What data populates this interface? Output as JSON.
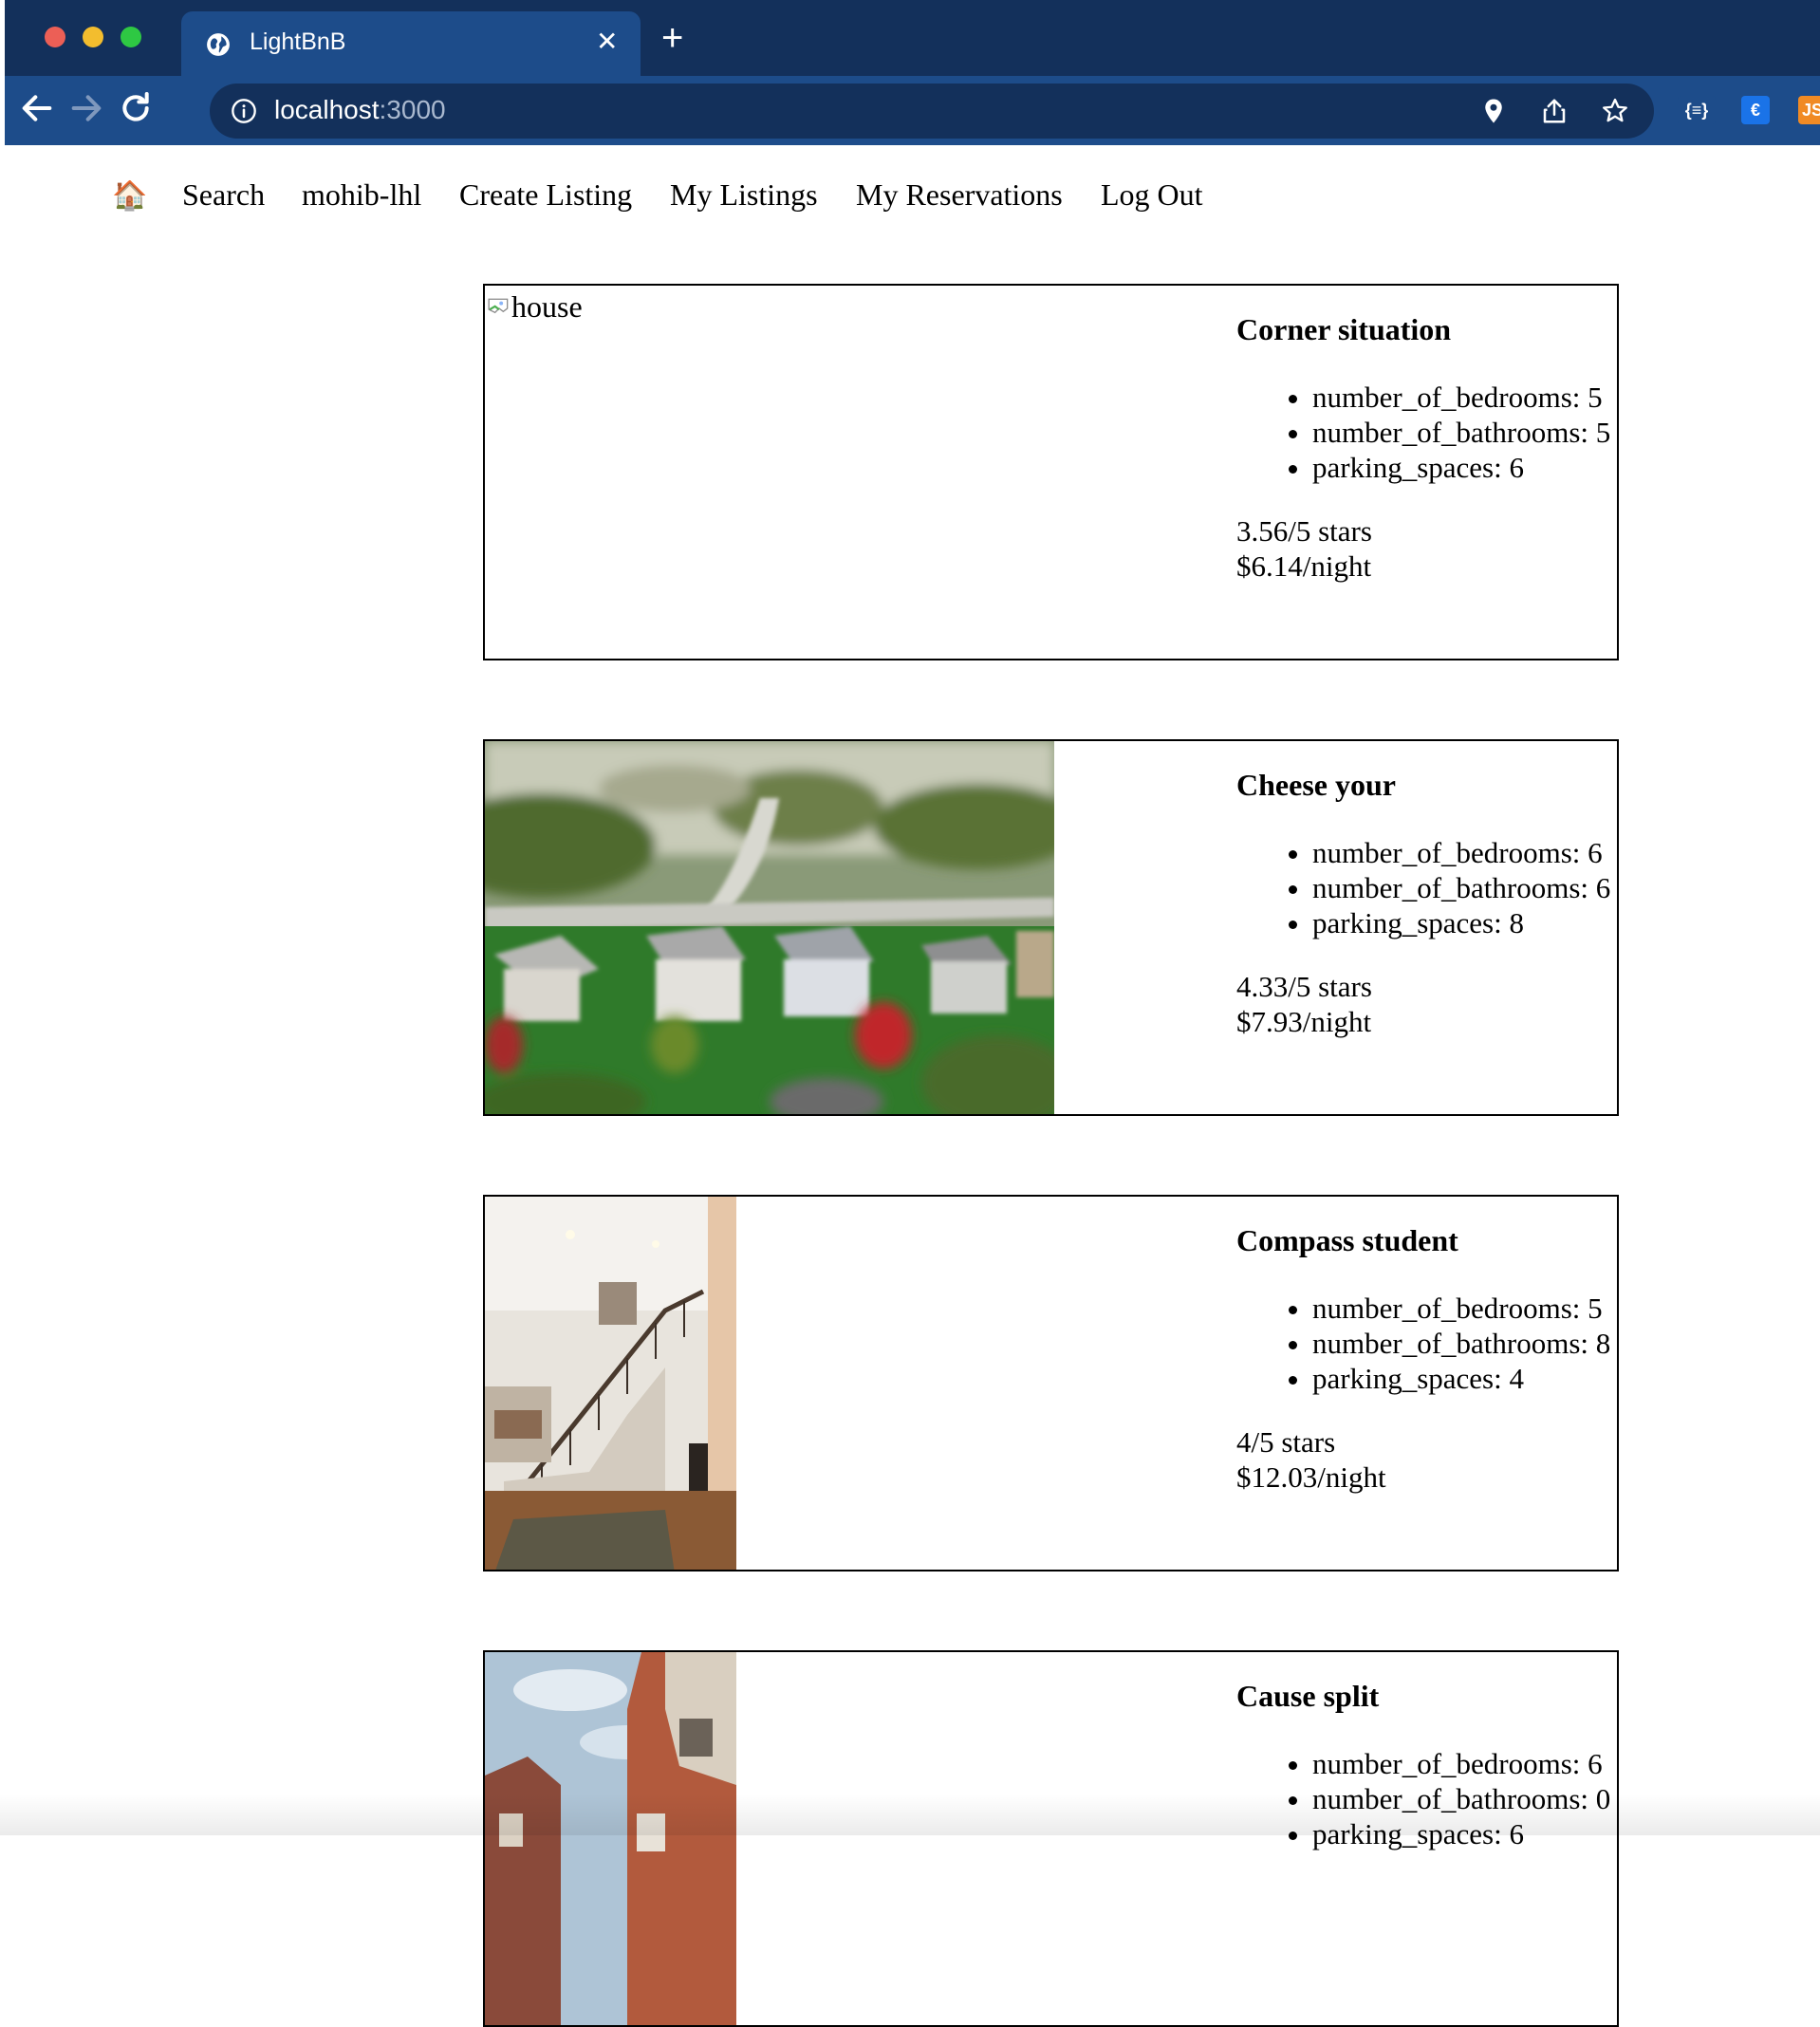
{
  "browser": {
    "tab_title": "LightBnB",
    "close_symbol": "✕",
    "new_tab_symbol": "+",
    "url_host": "localhost",
    "url_port": ":3000",
    "extensions": [
      {
        "name": "json-formatter-extension",
        "label": "{≡}",
        "bg": "#1d4c8a",
        "color": "#ffffff"
      },
      {
        "name": "currency-extension",
        "label": "€",
        "bg": "#1a73e8",
        "color": "#ffffff"
      },
      {
        "name": "js-extension",
        "label": "JS",
        "bg": "#f08a24",
        "color": "#ffffff"
      }
    ]
  },
  "nav": {
    "home_icon": "🏠",
    "search": "Search",
    "user": "mohib-lhl",
    "create_listing": "Create Listing",
    "my_listings": "My Listings",
    "my_reservations": "My Reservations",
    "log_out": "Log Out"
  },
  "listings": [
    {
      "title": "Corner situation",
      "image_alt": "house",
      "image_loaded": false,
      "bedrooms": "number_of_bedrooms: 5",
      "bathrooms": "number_of_bathrooms: 5",
      "parking": "parking_spaces: 6",
      "rating": "3.56/5 stars",
      "price": "$6.14/night"
    },
    {
      "title": "Cheese your",
      "image_alt": "house",
      "image_loaded": true,
      "image_scene": "aerial-suburb",
      "bedrooms": "number_of_bedrooms: 6",
      "bathrooms": "number_of_bathrooms: 6",
      "parking": "parking_spaces: 8",
      "rating": "4.33/5 stars",
      "price": "$7.93/night"
    },
    {
      "title": "Compass student",
      "image_alt": "house",
      "image_loaded": true,
      "image_scene": "interior-staircase",
      "bedrooms": "number_of_bedrooms: 5",
      "bathrooms": "number_of_bathrooms: 8",
      "parking": "parking_spaces: 4",
      "rating": "4/5 stars",
      "price": "$12.03/night"
    },
    {
      "title": "Cause split",
      "image_alt": "house",
      "image_loaded": true,
      "image_scene": "street-houses",
      "bedrooms": "number_of_bedrooms: 6",
      "bathrooms": "number_of_bathrooms: 0",
      "parking": "parking_spaces: 6"
    }
  ]
}
